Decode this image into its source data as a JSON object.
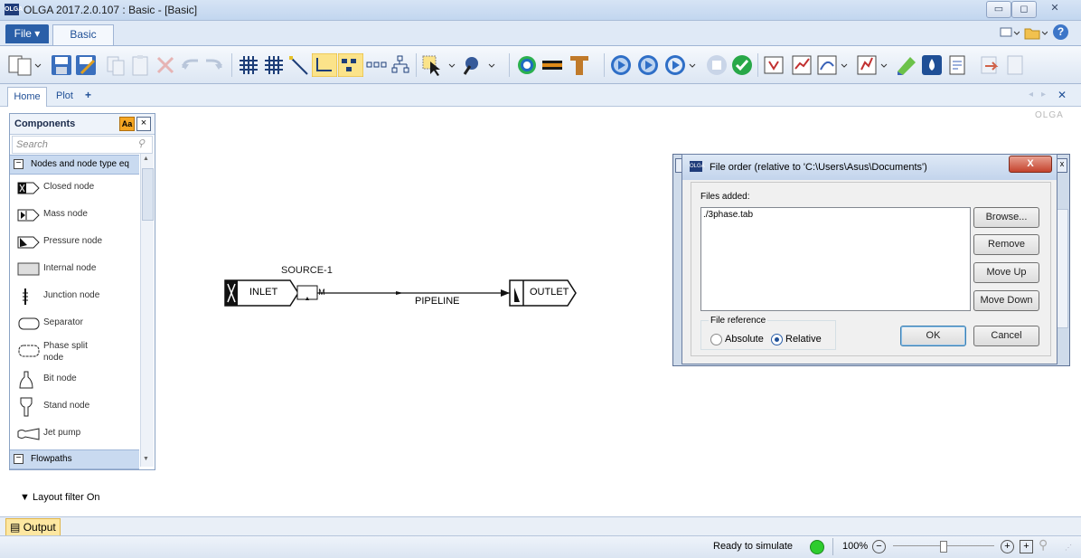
{
  "window": {
    "title": "OLGA 2017.2.0.107 : Basic - [Basic]",
    "app_icon_text": "OLGA"
  },
  "ribbon": {
    "file_label": "File ▾",
    "basic_tab": "Basic"
  },
  "doc_tabs": {
    "home": "Home",
    "plot": "Plot",
    "add": "+"
  },
  "canvas": {
    "watermark": "OLGA"
  },
  "components": {
    "title": "Components",
    "aa_label": "Aa",
    "close": "×",
    "search_placeholder": "Search",
    "group1": "Nodes and node type eq",
    "items": [
      {
        "label": "Closed node"
      },
      {
        "label": "Mass node"
      },
      {
        "label": "Pressure node"
      },
      {
        "label": "Internal node"
      },
      {
        "label": "Junction node"
      },
      {
        "label": "Separator"
      },
      {
        "label": "Phase split node"
      },
      {
        "label": "Bit node"
      },
      {
        "label": "Stand node"
      },
      {
        "label": "Jet pump"
      }
    ],
    "group2": "Flowpaths"
  },
  "diagram": {
    "source_label": "SOURCE-1",
    "source_box": "M",
    "inlet": "INLET",
    "outlet": "OUTLET",
    "pipeline": "PIPELINE"
  },
  "layout_filter": "Layout filter On",
  "dialog": {
    "title": "File order (relative to 'C:\\Users\\Asus\\Documents')",
    "close": "X",
    "files_added_label": "Files added:",
    "files": [
      "./3phase.tab"
    ],
    "browse": "Browse...",
    "remove": "Remove",
    "move_up": "Move Up",
    "move_down": "Move Down",
    "file_reference_label": "File reference",
    "absolute": "Absolute",
    "relative": "Relative",
    "selected_reference": "Relative",
    "ok": "OK",
    "cancel": "Cancel"
  },
  "output_tab": "Output",
  "status": {
    "text": "Ready to simulate",
    "zoom": "100%",
    "indicator_color": "#2ecc2e"
  }
}
